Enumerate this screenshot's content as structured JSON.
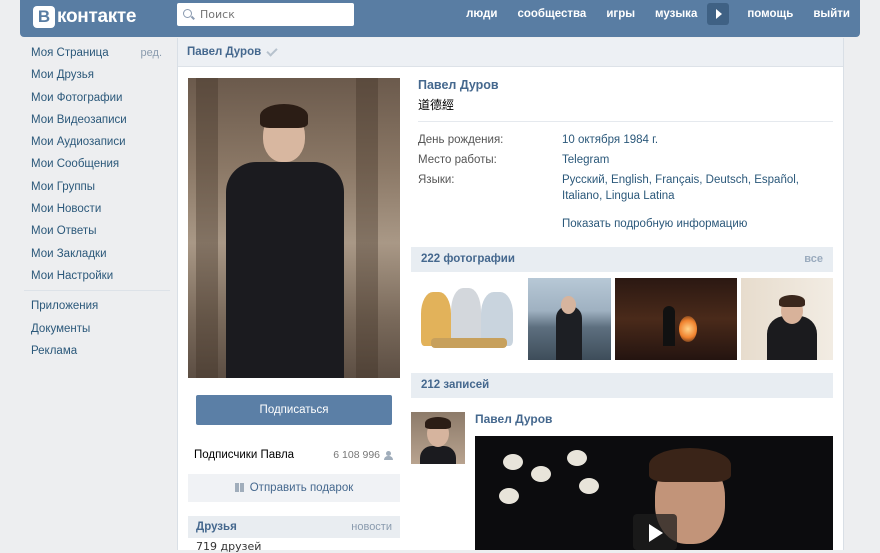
{
  "header": {
    "logo_letter": "B",
    "logo_text": "контакте",
    "search_placeholder": "Поиск",
    "nav": [
      "люди",
      "сообщества",
      "игры",
      "музыка",
      "помощь",
      "выйти"
    ]
  },
  "sidebar": {
    "edit_label": "ред.",
    "items": [
      "Моя Страница",
      "Мои Друзья",
      "Мои Фотографии",
      "Мои Видеозаписи",
      "Мои Аудиозаписи",
      "Мои Сообщения",
      "Мои Группы",
      "Мои Новости",
      "Мои Ответы",
      "Мои Закладки",
      "Мои Настройки"
    ],
    "extra": [
      "Приложения",
      "Документы",
      "Реклама"
    ]
  },
  "profile": {
    "header_name": "Павел Дуров",
    "name": "Павел Дуров",
    "status": "道德經",
    "fields": [
      {
        "label": "День рождения:",
        "value": "10 октября 1984 г."
      },
      {
        "label": "Место работы:",
        "value": "Telegram"
      },
      {
        "label": "Языки:",
        "value": "Русский, English, Français, Deutsch, Español, Italiano, Lingua Latina"
      }
    ],
    "more_info": "Показать подробную информацию",
    "subscribe_label": "Подписаться",
    "followers_label": "Подписчики Павла",
    "followers_count": "6 108 996",
    "gift_label": "Отправить подарок",
    "friends_title": "Друзья",
    "friends_link": "новости",
    "friends_count": "719 друзей"
  },
  "photos": {
    "title": "222 фотографии",
    "link": "все"
  },
  "wall": {
    "title": "212 записей",
    "post_author": "Павел Дуров"
  },
  "colors": {
    "topbar": "#597da3",
    "link": "#2b587a",
    "header_text": "#45688e",
    "button": "#5b7fa6"
  }
}
